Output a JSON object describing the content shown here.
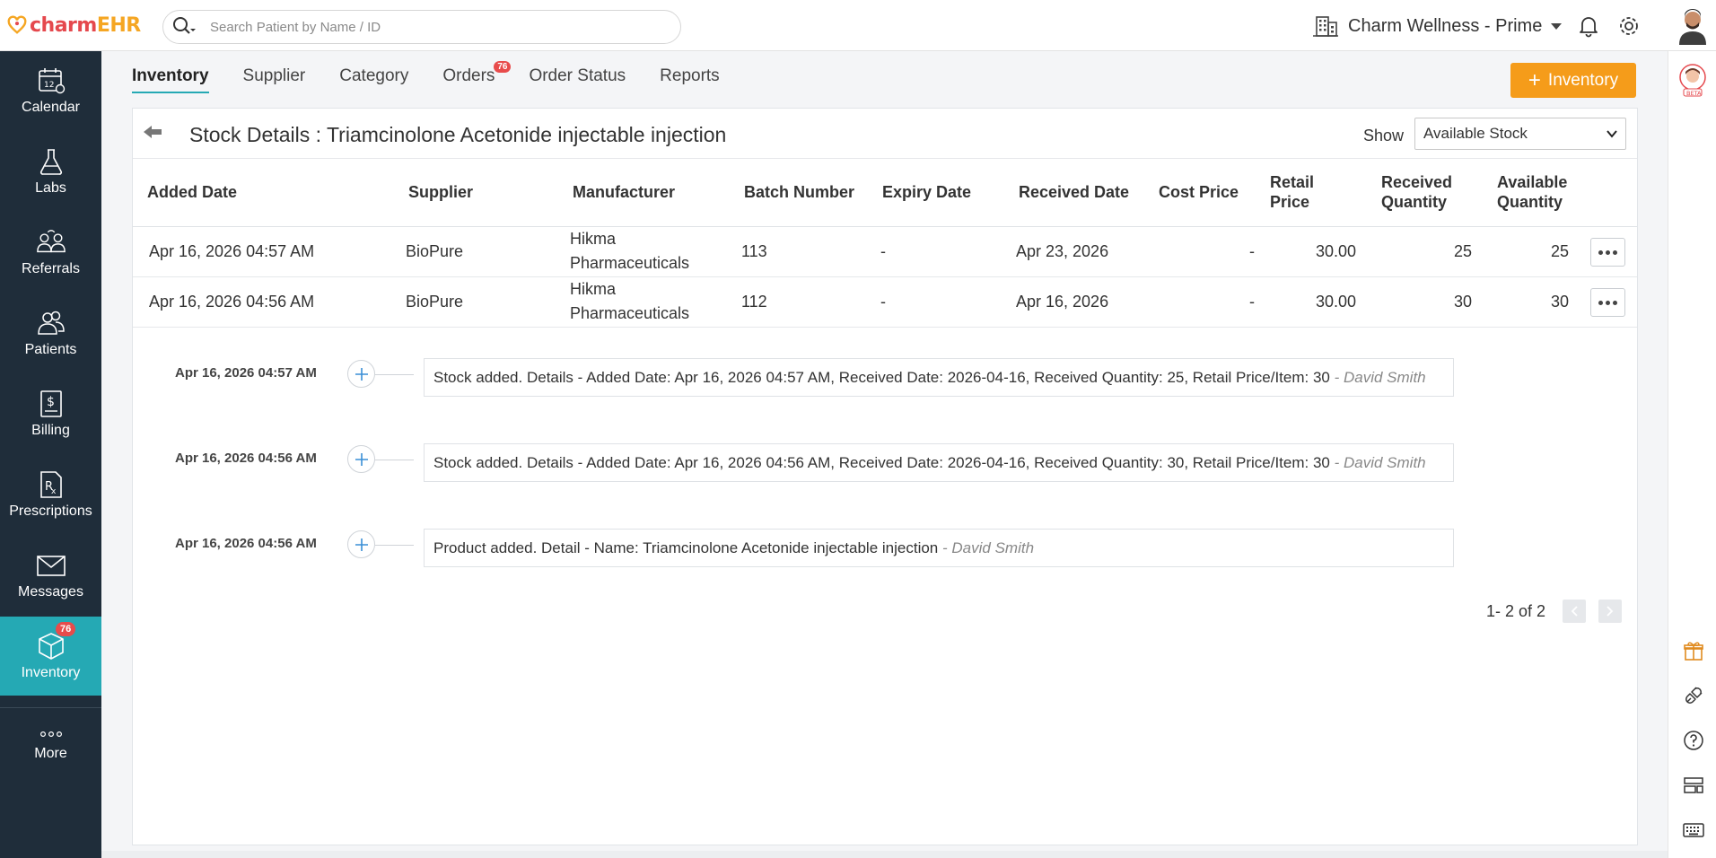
{
  "app": {
    "logo_a": "charm",
    "logo_b": "EHR",
    "search_placeholder": "Search Patient by Name / ID",
    "facility": "Charm Wellness - Prime"
  },
  "sidebar": {
    "items": [
      {
        "label": "Calendar",
        "icon": "calendar-icon"
      },
      {
        "label": "Labs",
        "icon": "flask-icon"
      },
      {
        "label": "Referrals",
        "icon": "referrals-icon"
      },
      {
        "label": "Patients",
        "icon": "patients-icon"
      },
      {
        "label": "Billing",
        "icon": "billing-icon"
      },
      {
        "label": "Prescriptions",
        "icon": "rx-icon"
      },
      {
        "label": "Messages",
        "icon": "envelope-icon"
      },
      {
        "label": "Inventory",
        "icon": "box-icon",
        "badge": "76"
      },
      {
        "label": "More",
        "icon": "more-dots-icon"
      }
    ]
  },
  "tabs": [
    {
      "label": "Inventory"
    },
    {
      "label": "Supplier"
    },
    {
      "label": "Category"
    },
    {
      "label": "Orders",
      "badge": "76"
    },
    {
      "label": "Order Status"
    },
    {
      "label": "Reports"
    }
  ],
  "add_button_label": "Inventory",
  "card": {
    "title": "Stock Details : Triamcinolone Acetonide injectable injection",
    "show_label": "Show",
    "show_value": "Available Stock"
  },
  "table": {
    "headers": {
      "added_date": "Added Date",
      "supplier": "Supplier",
      "manufacturer": "Manufacturer",
      "batch_number": "Batch Number",
      "expiry_date": "Expiry Date",
      "received_date": "Received Date",
      "cost_price": "Cost Price",
      "retail_price_1": "Retail",
      "retail_price_2": "Price",
      "received_qty_1": "Received",
      "received_qty_2": "Quantity",
      "available_qty_1": "Available",
      "available_qty_2": "Quantity"
    },
    "rows": [
      {
        "added_date": "Apr 16, 2026 04:57 AM",
        "supplier": "BioPure",
        "manufacturer_1": "Hikma",
        "manufacturer_2": "Pharmaceuticals",
        "batch_number": "113",
        "expiry_date": "-",
        "received_date": "Apr 23, 2026",
        "cost_price": "-",
        "retail_price": "30.00",
        "received_qty": "25",
        "available_qty": "25"
      },
      {
        "added_date": "Apr 16, 2026 04:56 AM",
        "supplier": "BioPure",
        "manufacturer_1": "Hikma",
        "manufacturer_2": "Pharmaceuticals",
        "batch_number": "112",
        "expiry_date": "-",
        "received_date": "Apr 16, 2026",
        "cost_price": "-",
        "retail_price": "30.00",
        "received_qty": "30",
        "available_qty": "30"
      }
    ]
  },
  "timeline": [
    {
      "date": "Apr 16, 2026 04:57 AM",
      "text": "Stock added. Details - Added Date: Apr 16, 2026 04:57 AM, Received Date: 2026-04-16, Received Quantity: 25, Retail Price/Item: 30",
      "author": "- David Smith"
    },
    {
      "date": "Apr 16, 2026 04:56 AM",
      "text": "Stock added. Details - Added Date: Apr 16, 2026 04:56 AM, Received Date: 2026-04-16, Received Quantity: 30, Retail Price/Item: 30",
      "author": "- David Smith"
    },
    {
      "date": "Apr 16, 2026 04:56 AM",
      "text": "Product added. Detail - Name: Triamcinolone Acetonide injectable injection",
      "author": "- David Smith"
    }
  ],
  "pager": {
    "text": "1- 2 of 2"
  },
  "colors": {
    "accent": "#25a9b4",
    "sidebar": "#1f2d3a",
    "primary_button": "#f59c1a",
    "badge": "#e84b4b"
  }
}
